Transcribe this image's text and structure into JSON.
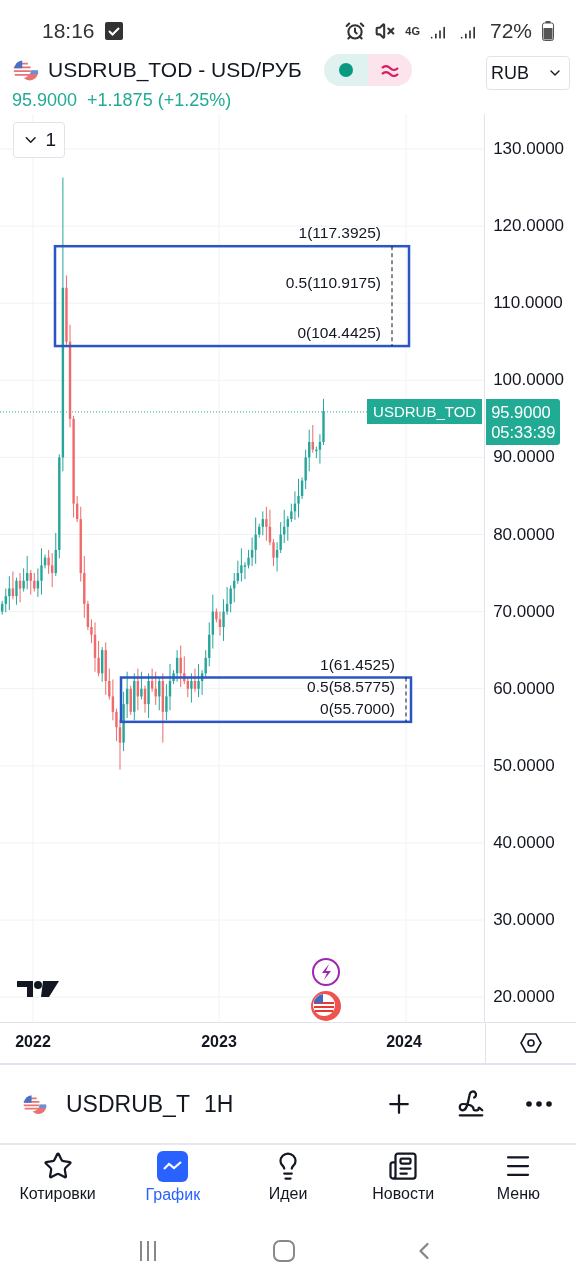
{
  "status_bar": {
    "time": "18:16",
    "network": "4G",
    "battery": "72%"
  },
  "header": {
    "title": "USDRUB_TOD - USD/РУБ",
    "currency": "RUB",
    "price": "95.9000",
    "change": "+1.1875 (+1.25%)",
    "interval": "1"
  },
  "chart": {
    "price_ticks": [
      "130.0000",
      "120.0000",
      "110.0000",
      "100.0000",
      "90.0000",
      "80.0000",
      "70.0000",
      "60.0000",
      "50.0000",
      "40.0000",
      "30.0000",
      "20.0000"
    ],
    "time_ticks": [
      "2022",
      "2023",
      "2024"
    ],
    "fib_boxes": [
      {
        "levels": [
          "1(117.3925)",
          "0.5(110.9175)",
          "0(104.4425)"
        ]
      },
      {
        "levels": [
          "1(61.4525)",
          "0.5(58.5775)",
          "0(55.7000)"
        ]
      }
    ],
    "last_price": {
      "symbol": "USDRUB_TOD",
      "price": "95.9000",
      "countdown": "05:33:39"
    }
  },
  "symbol_bar": {
    "symbol": "USDRUB_T",
    "interval": "1H"
  },
  "nav": [
    {
      "label": "Котировки",
      "selected": false
    },
    {
      "label": "График",
      "selected": true
    },
    {
      "label": "Идеи",
      "selected": false
    },
    {
      "label": "Новости",
      "selected": false
    },
    {
      "label": "Меню",
      "selected": false
    }
  ]
}
